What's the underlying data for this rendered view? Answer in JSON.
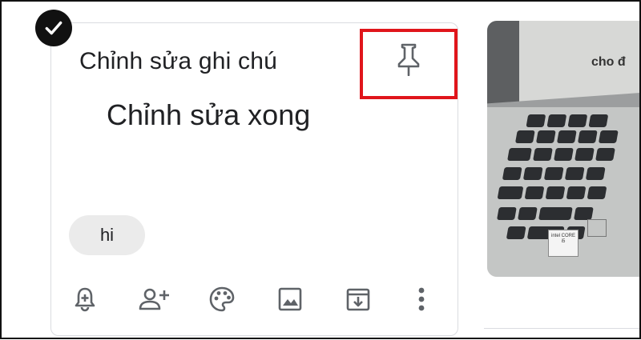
{
  "note": {
    "title": "Chỉnh sửa ghi chú",
    "body": "Chỉnh sửa xong",
    "label_chip": "hi"
  },
  "image_card": {
    "caption": "cho đ",
    "sticker_text": "intel CORE i5"
  },
  "icons": {
    "select": "check-circle-icon",
    "pin": "pin-icon",
    "toolbar": [
      "bell-plus-icon",
      "person-add-icon",
      "palette-icon",
      "image-icon",
      "archive-icon",
      "more-vert-icon"
    ]
  },
  "colors": {
    "highlight": "#e0151b",
    "chip_bg": "#ebebeb",
    "text": "#202124",
    "icon": "#5f6368"
  }
}
